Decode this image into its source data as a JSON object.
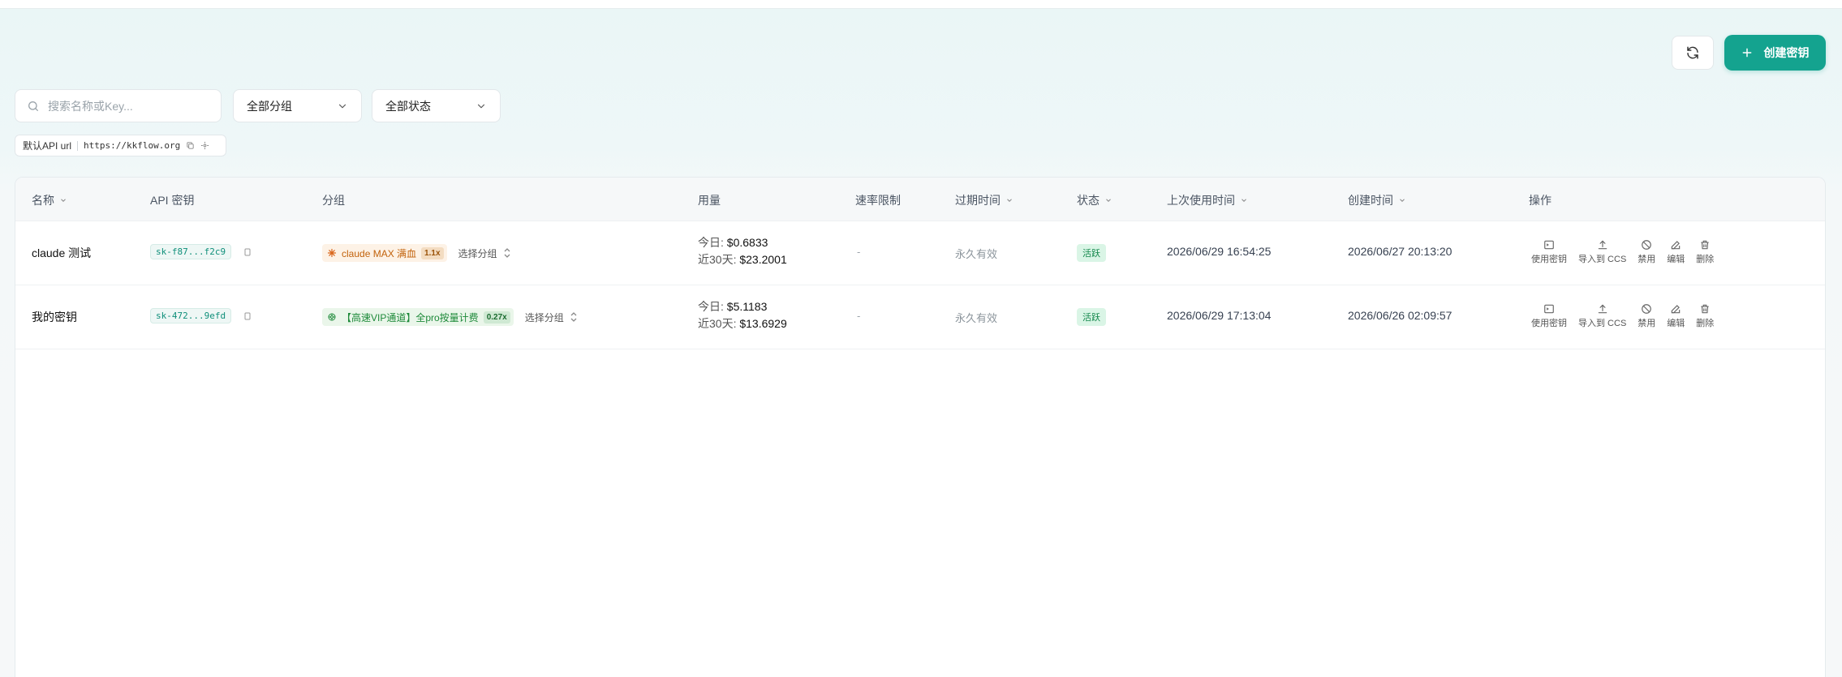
{
  "toolbar": {
    "create_label": "创建密钥"
  },
  "filters": {
    "search_placeholder": "搜索名称或Key...",
    "group_select": "全部分组",
    "status_select": "全部状态"
  },
  "api_url": {
    "label": "默认API url",
    "value": "https://kkflow.org"
  },
  "table": {
    "headers": {
      "name": "名称",
      "key": "API 密钥",
      "group": "分组",
      "usage": "用量",
      "rate": "速率限制",
      "expire": "过期时间",
      "status": "状态",
      "last_used": "上次使用时间",
      "created": "创建时间",
      "actions": "操作"
    },
    "rows": [
      {
        "name": "claude 测试",
        "key": "sk-f87...f2c9",
        "group": "claude MAX 满血",
        "multiplier": "1.1x",
        "select_group": "选择分组",
        "today_label": "今日:",
        "today": "$0.6833",
        "month_label": "近30天:",
        "month": "$23.2001",
        "rate": "-",
        "expire": "永久有效",
        "status": "活跃",
        "last_used": "2026/06/29 16:54:25",
        "created": "2026/06/27 20:13:20"
      },
      {
        "name": "我的密钥",
        "key": "sk-472...9efd",
        "group": "【高速VIP通道】全pro按量计费",
        "multiplier": "0.27x",
        "select_group": "选择分组",
        "today_label": "今日:",
        "today": "$5.1183",
        "month_label": "近30天:",
        "month": "$13.6929",
        "rate": "-",
        "expire": "永久有效",
        "status": "活跃",
        "last_used": "2026/06/29 17:13:04",
        "created": "2026/06/26 02:09:57"
      }
    ],
    "actions": {
      "use": "使用密钥",
      "import": "导入到 CCS",
      "disable": "禁用",
      "edit": "编辑",
      "delete": "删除"
    }
  },
  "colors": {
    "accent": "#14a38f",
    "status_active_bg": "#daf5e6",
    "status_active_text": "#13874b"
  }
}
